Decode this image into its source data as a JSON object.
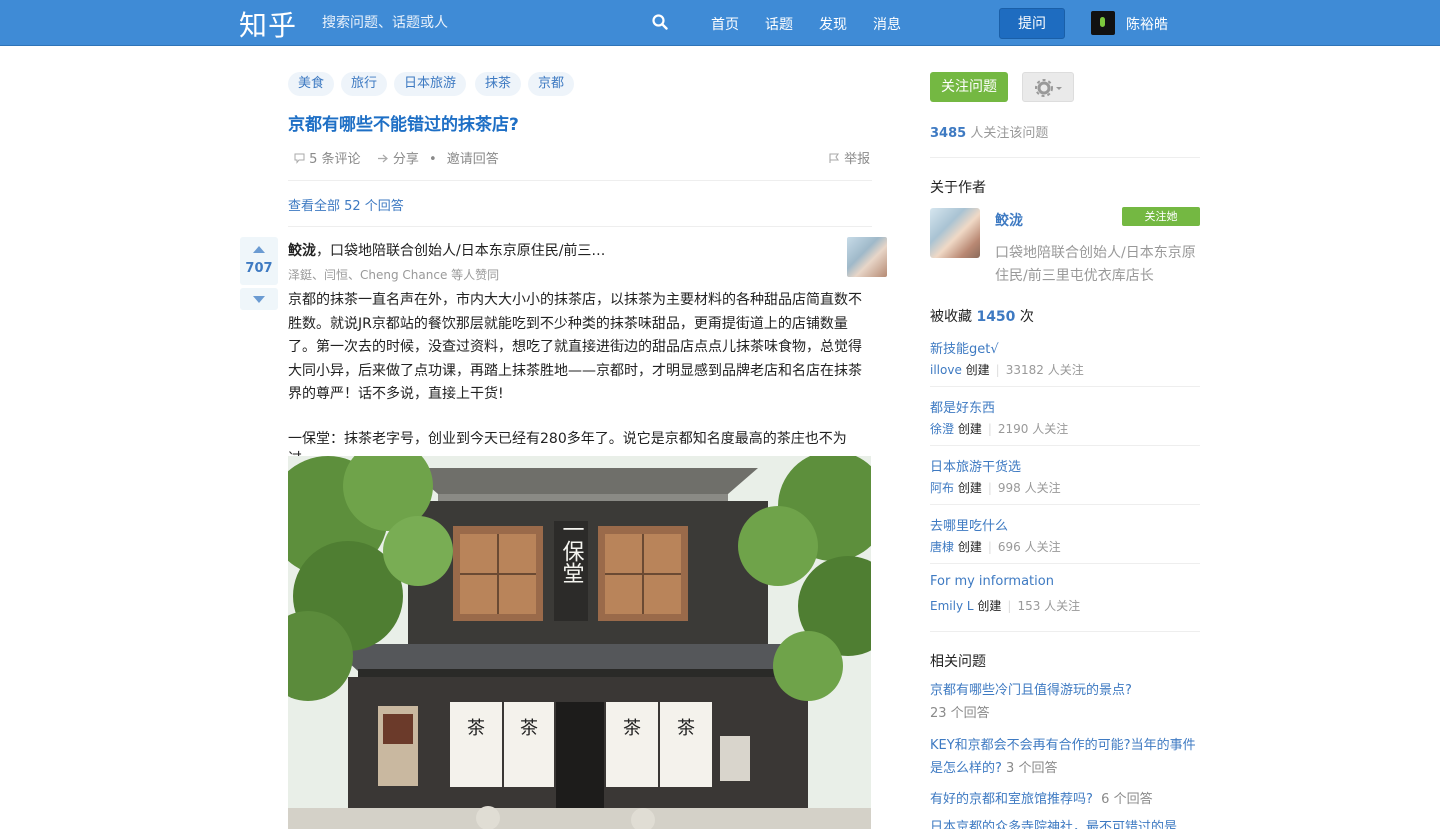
{
  "header": {
    "logo": "知乎",
    "search_placeholder": "搜索问题、话题或人",
    "nav": [
      "首页",
      "话题",
      "发现",
      "消息"
    ],
    "ask_label": "提问",
    "user_name": "陈裕皓"
  },
  "question": {
    "tags": [
      "美食",
      "旅行",
      "日本旅游",
      "抹茶",
      "京都"
    ],
    "title": "京都有哪些不能错过的抹茶店?",
    "comments": "5 条评论",
    "share": "分享",
    "bullet": "•",
    "invite": "邀请回答",
    "report": "举报",
    "view_all": "查看全部 52 个回答"
  },
  "answer": {
    "votes": "707",
    "author_name": "鲛泷",
    "author_bio": "，口袋地陪联合创始人/日本东京原住民/前三…",
    "voters": "泽鋌、闫恒、Cheng Chance 等人赞同",
    "paragraph1": "京都的抹茶一直名声在外，市内大大小小的抹茶店，以抹茶为主要材料的各种甜品店简直数不胜数。就说JR京都站的餐饮那层就能吃到不少种类的抹茶味甜品，更甭提街道上的店铺数量了。第一次去的时候，没查过资料，想吃了就直接进街边的甜品店点点儿抹茶味食物，总觉得大同小异，后来做了点功课，再踏上抹茶胜地——京都时，才明显感到品牌老店和名店在抹茶界的尊严！话不多说，直接上干货!",
    "paragraph2": "一保堂：抹茶老字号，创业到今天已经有280多年了。说它是京都知名度最高的茶庄也不为过。"
  },
  "sidebar": {
    "follow_question": "关注问题",
    "followers_count": "3485",
    "followers_text": " 人关注该问题",
    "about_author": "关于作者",
    "author_name": "鲛泷",
    "follow_her": "关注她",
    "author_bio": "口袋地陪联合创始人/日本东京原住民/前三里屯优衣库店长",
    "collected_prefix": "被收藏 ",
    "collected_count": "1450",
    "collected_suffix": " 次",
    "collections": [
      {
        "title": "新技能get√",
        "creator": "illove",
        "created": "创建",
        "followers": "33182 人关注"
      },
      {
        "title": "都是好东西",
        "creator": "徐澄",
        "created": "创建",
        "followers": "2190 人关注"
      },
      {
        "title": "日本旅游干货选",
        "creator": "阿布",
        "created": "创建",
        "followers": "998 人关注"
      },
      {
        "title": "去哪里吃什么",
        "creator": "唐棣",
        "created": "创建",
        "followers": "696 人关注"
      },
      {
        "title": "For my information",
        "creator": "Emily L",
        "created": "创建",
        "followers": "153 人关注"
      }
    ],
    "related_heading": "相关问题",
    "related": [
      {
        "title": "京都有哪些冷门且值得游玩的景点?",
        "count": "23 个回答"
      },
      {
        "title": "KEY和京都会不会再有合作的可能?当年的事件是怎么样的?",
        "count": "3 个回答"
      },
      {
        "title": "有好的京都和室旅馆推荐吗?",
        "count": "6 个回答"
      },
      {
        "title": "日本京都的众多寺院神社，最不可错过的是",
        "count": ""
      }
    ]
  },
  "photo": {
    "sign_text": "一保堂",
    "noren_text": [
      "茶",
      "茶",
      "茶",
      "茶"
    ]
  }
}
